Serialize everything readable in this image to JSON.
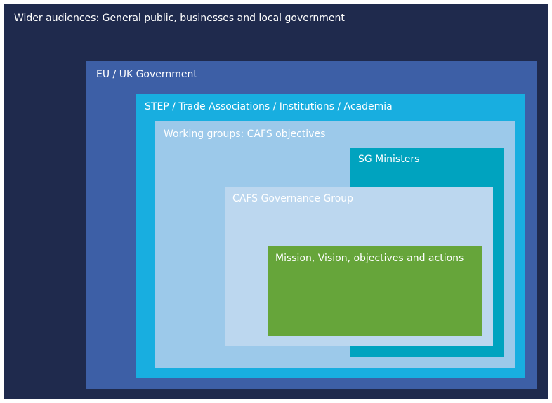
{
  "layers": {
    "wider": {
      "label": "Wider audiences: General public, businesses and local government",
      "bg": "#1f2a4d",
      "color": "#ffffff"
    },
    "eu": {
      "label": "EU / UK Government",
      "bg": "#3d5fa6",
      "color": "#ffffff"
    },
    "step": {
      "label": "STEP / Trade Associations / Institutions / Academia",
      "bg": "#18aee0",
      "color": "#ffffff"
    },
    "working_groups": {
      "label": "Working groups: CAFS objectives",
      "bg": "#9cc9ea",
      "color": "#ffffff"
    },
    "sg_ministers": {
      "label": "SG Ministers",
      "bg": "#00a3bf",
      "color": "#ffffff"
    },
    "cafs_governance": {
      "label": "CAFS Governance Group",
      "bg": "#bcd7ef",
      "color": "#ffffff"
    },
    "mission": {
      "label": "Mission, Vision, objectives and actions",
      "bg": "#66a53a",
      "color": "#ffffff"
    }
  }
}
